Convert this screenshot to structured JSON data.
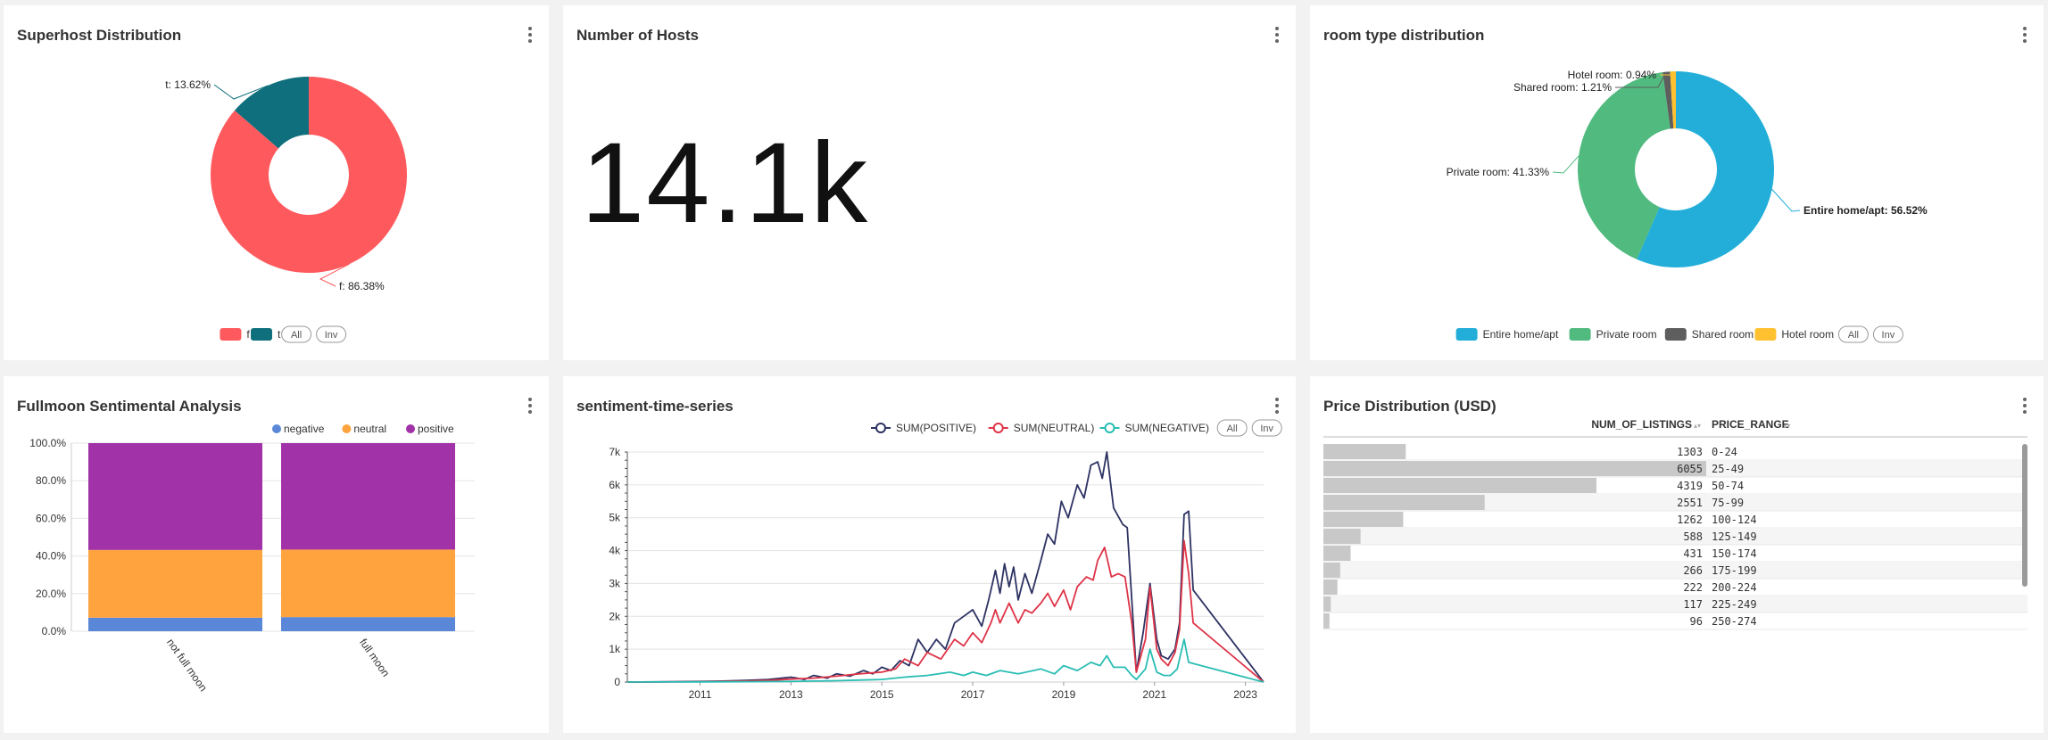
{
  "colors": {
    "f": "#fe5a5d",
    "t": "#0f6f7c",
    "entire": "#22aed8",
    "private": "#51ba7f",
    "shared": "#5e5e5e",
    "hotel": "#ffc12f",
    "negative": "#5b87d8",
    "neutral": "#ffa33e",
    "positive": "#a232a8",
    "pos_line": "#2d3262",
    "neu_line": "#de3448",
    "neg_line": "#29bdb3",
    "bar_fill": "#c8c8c8"
  },
  "panels": {
    "superhost": {
      "title": "Superhost Distribution"
    },
    "hosts": {
      "title": "Number of Hosts",
      "value": "14.1k"
    },
    "roomtype": {
      "title": "room type distribution"
    },
    "fullmoon": {
      "title": "Fullmoon Sentimental Analysis"
    },
    "sentiment": {
      "title": "sentiment-time-series"
    },
    "price": {
      "title": "Price Distribution (USD)"
    }
  },
  "legend_controls": {
    "all": "All",
    "inv": "Inv"
  },
  "chart_data": [
    {
      "id": "superhost",
      "type": "pie",
      "title": "Superhost Distribution",
      "donut": true,
      "slices": [
        {
          "label": "f",
          "value": 86.38,
          "slice_label": "f: 86.38%",
          "color_key": "f"
        },
        {
          "label": "t",
          "value": 13.62,
          "slice_label": "t: 13.62%",
          "color_key": "t"
        }
      ],
      "legend": [
        "f",
        "t"
      ],
      "legend_placement": "bottom"
    },
    {
      "id": "roomtype",
      "type": "pie",
      "title": "room type distribution",
      "donut": true,
      "slices": [
        {
          "label": "Entire home/apt",
          "value": 56.52,
          "slice_label": "Entire home/apt: 56.52%",
          "color_key": "entire"
        },
        {
          "label": "Private room",
          "value": 41.33,
          "slice_label": "Private room: 41.33%",
          "color_key": "private"
        },
        {
          "label": "Shared room",
          "value": 1.21,
          "slice_label": "Shared room: 1.21%",
          "color_key": "shared"
        },
        {
          "label": "Hotel room",
          "value": 0.94,
          "slice_label": "Hotel room: 0.94%",
          "color_key": "hotel"
        }
      ],
      "legend": [
        "Entire home/apt",
        "Private room",
        "Shared room",
        "Hotel room"
      ],
      "legend_placement": "bottom"
    },
    {
      "id": "fullmoon",
      "type": "bar",
      "stacked": true,
      "percent": true,
      "title": "Fullmoon Sentimental Analysis",
      "categories": [
        "not full moon",
        "full moon"
      ],
      "series": [
        {
          "name": "negative",
          "values": [
            7.2,
            7.5
          ],
          "color_key": "negative"
        },
        {
          "name": "neutral",
          "values": [
            36.0,
            35.9
          ],
          "color_key": "neutral"
        },
        {
          "name": "positive",
          "values": [
            56.8,
            56.6
          ],
          "color_key": "positive"
        }
      ],
      "yticks": [
        "0.0%",
        "20.0%",
        "40.0%",
        "60.0%",
        "80.0%",
        "100.0%"
      ],
      "ylim": [
        0,
        100
      ],
      "legend_placement": "top-right"
    },
    {
      "id": "sentiment",
      "type": "line",
      "title": "sentiment-time-series",
      "xlim": [
        2009.4,
        2023.4
      ],
      "ylim": [
        0,
        7000
      ],
      "xticks": [
        "2011",
        "2013",
        "2015",
        "2017",
        "2019",
        "2021",
        "2023"
      ],
      "yticks": [
        "0",
        "1k",
        "2k",
        "3k",
        "4k",
        "5k",
        "6k",
        "7k"
      ],
      "grid": true,
      "legend_placement": "top-right",
      "series": [
        {
          "name": "SUM(POSITIVE)",
          "color_key": "pos_line",
          "points": [
            [
              2009.4,
              0
            ],
            [
              2010,
              5
            ],
            [
              2011,
              20
            ],
            [
              2011.5,
              30
            ],
            [
              2012,
              50
            ],
            [
              2012.5,
              80
            ],
            [
              2013,
              150
            ],
            [
              2013.3,
              80
            ],
            [
              2013.5,
              200
            ],
            [
              2013.8,
              120
            ],
            [
              2014,
              250
            ],
            [
              2014.3,
              180
            ],
            [
              2014.6,
              350
            ],
            [
              2014.8,
              250
            ],
            [
              2015,
              450
            ],
            [
              2015.2,
              350
            ],
            [
              2015.4,
              650
            ],
            [
              2015.6,
              500
            ],
            [
              2015.8,
              1300
            ],
            [
              2016,
              900
            ],
            [
              2016.2,
              1300
            ],
            [
              2016.4,
              1000
            ],
            [
              2016.6,
              1800
            ],
            [
              2016.8,
              2000
            ],
            [
              2017,
              2200
            ],
            [
              2017.2,
              1700
            ],
            [
              2017.35,
              2500
            ],
            [
              2017.5,
              3400
            ],
            [
              2017.6,
              2700
            ],
            [
              2017.7,
              3600
            ],
            [
              2017.8,
              2900
            ],
            [
              2017.9,
              3500
            ],
            [
              2018,
              2500
            ],
            [
              2018.15,
              3300
            ],
            [
              2018.3,
              2700
            ],
            [
              2018.5,
              3700
            ],
            [
              2018.65,
              4500
            ],
            [
              2018.8,
              4200
            ],
            [
              2018.95,
              5500
            ],
            [
              2019.1,
              5000
            ],
            [
              2019.3,
              6000
            ],
            [
              2019.45,
              5600
            ],
            [
              2019.6,
              6600
            ],
            [
              2019.75,
              6700
            ],
            [
              2019.85,
              6200
            ],
            [
              2019.95,
              7000
            ],
            [
              2020.1,
              5300
            ],
            [
              2020.3,
              4800
            ],
            [
              2020.4,
              4700
            ],
            [
              2020.5,
              2500
            ],
            [
              2020.6,
              300
            ],
            [
              2020.75,
              1500
            ],
            [
              2020.9,
              3000
            ],
            [
              2021.05,
              1300
            ],
            [
              2021.15,
              800
            ],
            [
              2021.3,
              700
            ],
            [
              2021.45,
              1000
            ],
            [
              2021.55,
              1800
            ],
            [
              2021.65,
              5100
            ],
            [
              2021.75,
              5200
            ],
            [
              2021.85,
              2800
            ],
            [
              2023.4,
              0
            ]
          ]
        },
        {
          "name": "SUM(NEUTRAL)",
          "color_key": "neu_line",
          "points": [
            [
              2009.4,
              0
            ],
            [
              2010,
              3
            ],
            [
              2011,
              10
            ],
            [
              2012,
              30
            ],
            [
              2012.5,
              50
            ],
            [
              2013,
              90
            ],
            [
              2013.5,
              120
            ],
            [
              2014,
              180
            ],
            [
              2014.5,
              250
            ],
            [
              2015,
              300
            ],
            [
              2015.3,
              400
            ],
            [
              2015.5,
              700
            ],
            [
              2015.8,
              500
            ],
            [
              2016,
              900
            ],
            [
              2016.3,
              700
            ],
            [
              2016.6,
              1300
            ],
            [
              2016.8,
              1100
            ],
            [
              2017,
              1500
            ],
            [
              2017.2,
              1200
            ],
            [
              2017.4,
              1800
            ],
            [
              2017.5,
              2200
            ],
            [
              2017.6,
              1800
            ],
            [
              2017.8,
              2400
            ],
            [
              2018,
              1800
            ],
            [
              2018.15,
              2200
            ],
            [
              2018.3,
              2100
            ],
            [
              2018.5,
              2400
            ],
            [
              2018.65,
              2700
            ],
            [
              2018.8,
              2300
            ],
            [
              2019,
              2800
            ],
            [
              2019.15,
              2200
            ],
            [
              2019.3,
              2900
            ],
            [
              2019.5,
              3200
            ],
            [
              2019.65,
              3100
            ],
            [
              2019.75,
              3700
            ],
            [
              2019.9,
              4100
            ],
            [
              2020.05,
              3200
            ],
            [
              2020.2,
              3300
            ],
            [
              2020.35,
              3200
            ],
            [
              2020.5,
              1800
            ],
            [
              2020.6,
              300
            ],
            [
              2020.8,
              1300
            ],
            [
              2020.9,
              2900
            ],
            [
              2021.05,
              1000
            ],
            [
              2021.15,
              700
            ],
            [
              2021.3,
              500
            ],
            [
              2021.45,
              900
            ],
            [
              2021.55,
              1600
            ],
            [
              2021.65,
              4300
            ],
            [
              2021.75,
              3300
            ],
            [
              2021.85,
              1800
            ],
            [
              2023.4,
              0
            ]
          ]
        },
        {
          "name": "SUM(NEGATIVE)",
          "color_key": "neg_line",
          "points": [
            [
              2009.4,
              0
            ],
            [
              2010,
              2
            ],
            [
              2011,
              5
            ],
            [
              2012,
              10
            ],
            [
              2013,
              20
            ],
            [
              2014,
              40
            ],
            [
              2014.5,
              60
            ],
            [
              2015,
              80
            ],
            [
              2015.5,
              150
            ],
            [
              2016,
              200
            ],
            [
              2016.5,
              300
            ],
            [
              2016.8,
              200
            ],
            [
              2017,
              300
            ],
            [
              2017.3,
              200
            ],
            [
              2017.6,
              350
            ],
            [
              2018,
              250
            ],
            [
              2018.5,
              400
            ],
            [
              2018.8,
              250
            ],
            [
              2019,
              500
            ],
            [
              2019.3,
              350
            ],
            [
              2019.6,
              600
            ],
            [
              2019.8,
              500
            ],
            [
              2019.95,
              800
            ],
            [
              2020.1,
              450
            ],
            [
              2020.35,
              450
            ],
            [
              2020.5,
              200
            ],
            [
              2020.6,
              80
            ],
            [
              2020.8,
              400
            ],
            [
              2020.9,
              1000
            ],
            [
              2021.05,
              300
            ],
            [
              2021.2,
              200
            ],
            [
              2021.35,
              200
            ],
            [
              2021.5,
              400
            ],
            [
              2021.65,
              1300
            ],
            [
              2021.75,
              600
            ],
            [
              2023.4,
              0
            ]
          ]
        }
      ]
    },
    {
      "id": "price",
      "type": "table",
      "title": "Price Distribution (USD)",
      "columns": [
        "NUM_OF_LISTINGS",
        "PRICE_RANGE"
      ],
      "rows": [
        [
          1303,
          "0-24"
        ],
        [
          6055,
          "25-49"
        ],
        [
          4319,
          "50-74"
        ],
        [
          2551,
          "75-99"
        ],
        [
          1262,
          "100-124"
        ],
        [
          588,
          "125-149"
        ],
        [
          431,
          "150-174"
        ],
        [
          266,
          "175-199"
        ],
        [
          222,
          "200-224"
        ],
        [
          117,
          "225-249"
        ],
        [
          96,
          "250-274"
        ]
      ]
    }
  ]
}
